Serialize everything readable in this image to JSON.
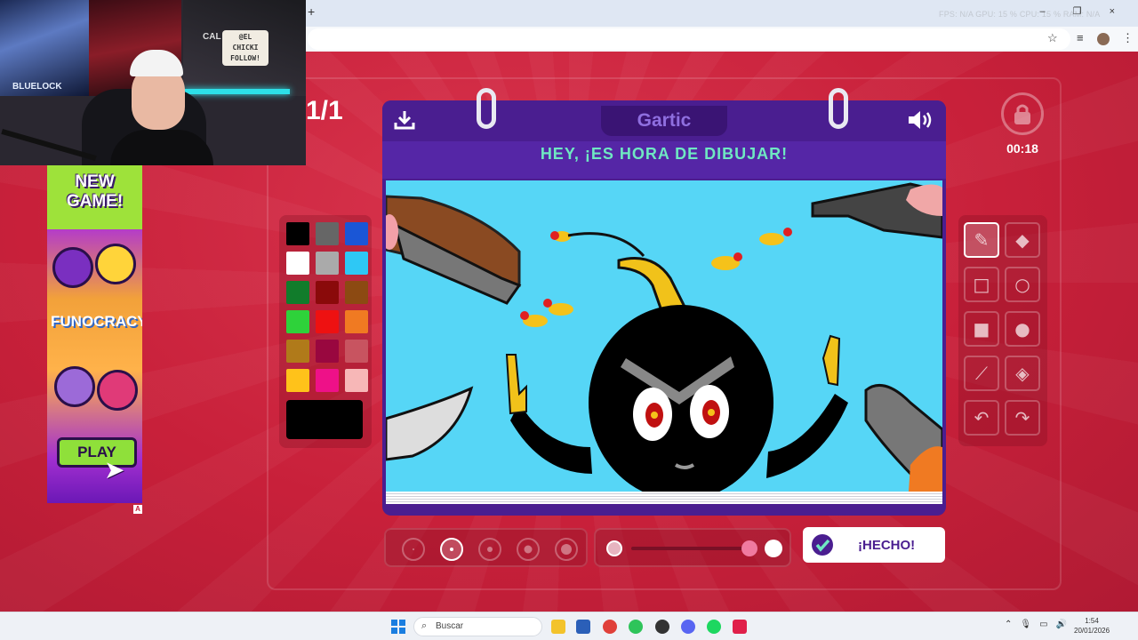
{
  "browser": {
    "new_tab": "+",
    "stats": "FPS: N/A   GPU: 15 %   CPU: 15 %   RAM: N/A",
    "window_controls": "– ❐ ×"
  },
  "game": {
    "round": "1/1",
    "logo": "Gartic",
    "prompt": "HEY, ¡ES HORA DE DIBUJAR!",
    "timer": "00:18",
    "done_label": "¡HECHO!",
    "accent": "#4a1e90",
    "prompt_color": "#6fe8c2",
    "palette": [
      "#000000",
      "#666666",
      "#1a56d6",
      "#ffffff",
      "#aaaaaa",
      "#2ec8f5",
      "#117c2b",
      "#8a0a0a",
      "#8c4a12",
      "#2ed23a",
      "#ee1111",
      "#f07a22",
      "#b07a1a",
      "#99073f",
      "#c85460",
      "#ffc21a",
      "#ee1188",
      "#f7b7b7"
    ],
    "selected_color": "#000000",
    "tools": [
      "pencil-icon",
      "eraser-icon",
      "rectangle-outline-icon",
      "circle-outline-icon",
      "rectangle-fill-icon",
      "circle-fill-icon",
      "line-icon",
      "fill-bucket-icon",
      "undo-icon",
      "redo-icon"
    ],
    "selected_brush_size": 2
  },
  "ad": {
    "title_1": "NEW",
    "title_2": "GAME!",
    "logo": "FUNOCRACY",
    "play": "PLAY",
    "badge": "A"
  },
  "webcam": {
    "sign_1": "@EL",
    "sign_2": "CHICKI",
    "sign_3": "FOLLOW!",
    "poster_text": "BLUELOCK",
    "poster_text_2": "CAL"
  },
  "taskbar": {
    "search_placeholder": "Buscar",
    "time": "1:54",
    "date": "20/01/2026"
  }
}
